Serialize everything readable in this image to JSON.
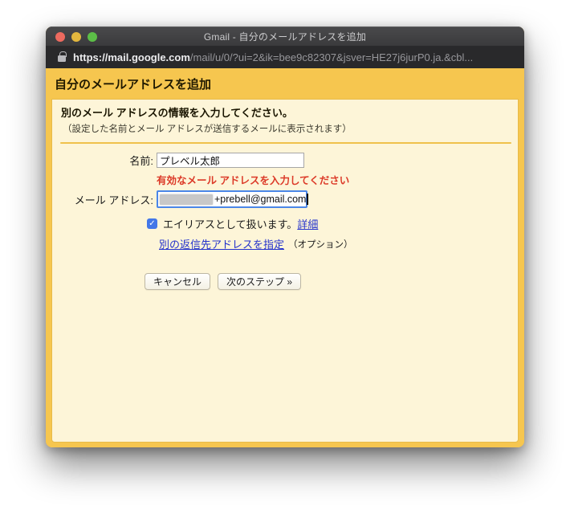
{
  "window": {
    "title": "Gmail - 自分のメールアドレスを追加"
  },
  "url_bar": {
    "url_domain": "https://mail.google.com",
    "url_path": "/mail/u/0/?ui=2&ik=bee9c82307&jsver=HE27j6jurP0.ja.&cbl..."
  },
  "header": {
    "title": "自分のメールアドレスを追加"
  },
  "intro": {
    "heading": "別のメール アドレスの情報を入力してください。",
    "note": "（設定した名前とメール アドレスが送信するメールに表示されます）"
  },
  "form": {
    "name_label": "名前:",
    "name_value": "プレベル太郎",
    "error_message": "有効なメール アドレスを入力してください",
    "email_label": "メール アドレス:",
    "email_visible_value": "+prebell@gmail.com",
    "alias_checkbox_checked": true,
    "checkmark": "✓",
    "alias_label": "エイリアスとして扱います。",
    "alias_details_link": "詳細",
    "reply_to_link": "別の返信先アドレスを指定",
    "reply_to_note": "（オプション）"
  },
  "buttons": {
    "cancel": "キャンセル",
    "next": "次のステップ »"
  },
  "colors": {
    "gold_header": "#f6c64f",
    "panel_bg": "#fdf5d8",
    "separator_gold": "#efc14b",
    "error_red": "#dc3a28",
    "link_blue": "#2432cc",
    "checkbox_blue": "#4377e8",
    "focus_border_blue": "#4a86e8",
    "titlebar_bg": "#3d3d3f",
    "urlbar_bg": "#29292b",
    "traffic_red": "#ed6a5f",
    "traffic_yellow": "#e3b73e",
    "traffic_green": "#5cbe47"
  }
}
